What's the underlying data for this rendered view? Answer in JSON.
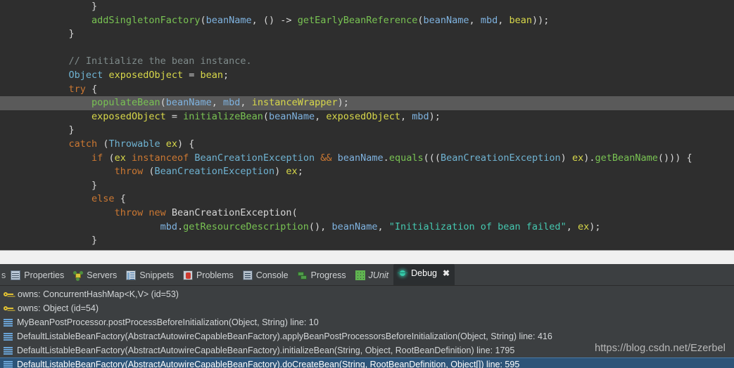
{
  "editor": {
    "language": "java",
    "theme_bg": "#2e2e2e",
    "highlight_bg": "#5a5a5a",
    "highlighted_line_index": 7,
    "lines": [
      {
        "indent": 8,
        "tokens": [
          {
            "t": "}",
            "c": "punc"
          }
        ]
      },
      {
        "indent": 8,
        "tokens": [
          {
            "t": "addSingletonFactory",
            "c": "method"
          },
          {
            "t": "(",
            "c": "punc"
          },
          {
            "t": "beanName",
            "c": "field"
          },
          {
            "t": ", () -> ",
            "c": "punc"
          },
          {
            "t": "getEarlyBeanReference",
            "c": "method"
          },
          {
            "t": "(",
            "c": "punc"
          },
          {
            "t": "beanName",
            "c": "field"
          },
          {
            "t": ", ",
            "c": "punc"
          },
          {
            "t": "mbd",
            "c": "field"
          },
          {
            "t": ", ",
            "c": "punc"
          },
          {
            "t": "bean",
            "c": "var"
          },
          {
            "t": "));",
            "c": "punc"
          }
        ]
      },
      {
        "indent": 4,
        "tokens": [
          {
            "t": "}",
            "c": "punc"
          }
        ]
      },
      {
        "indent": 0,
        "tokens": []
      },
      {
        "indent": 4,
        "tokens": [
          {
            "t": "// Initialize the bean instance.",
            "c": "comment"
          }
        ]
      },
      {
        "indent": 4,
        "tokens": [
          {
            "t": "Object",
            "c": "type"
          },
          {
            "t": " ",
            "c": "punc"
          },
          {
            "t": "exposedObject",
            "c": "var"
          },
          {
            "t": " = ",
            "c": "punc"
          },
          {
            "t": "bean",
            "c": "var"
          },
          {
            "t": ";",
            "c": "punc"
          }
        ]
      },
      {
        "indent": 4,
        "tokens": [
          {
            "t": "try",
            "c": "kw"
          },
          {
            "t": " {",
            "c": "punc"
          }
        ]
      },
      {
        "indent": 8,
        "tokens": [
          {
            "t": "populateBean",
            "c": "method"
          },
          {
            "t": "(",
            "c": "punc"
          },
          {
            "t": "beanName",
            "c": "field"
          },
          {
            "t": ", ",
            "c": "punc"
          },
          {
            "t": "mbd",
            "c": "field"
          },
          {
            "t": ", ",
            "c": "punc"
          },
          {
            "t": "instanceWrapper",
            "c": "var"
          },
          {
            "t": ");",
            "c": "punc"
          }
        ]
      },
      {
        "indent": 8,
        "tokens": [
          {
            "t": "exposedObject",
            "c": "var"
          },
          {
            "t": " = ",
            "c": "punc"
          },
          {
            "t": "initializeBean",
            "c": "method"
          },
          {
            "t": "(",
            "c": "punc"
          },
          {
            "t": "beanName",
            "c": "field"
          },
          {
            "t": ", ",
            "c": "punc"
          },
          {
            "t": "exposedObject",
            "c": "var"
          },
          {
            "t": ", ",
            "c": "punc"
          },
          {
            "t": "mbd",
            "c": "field"
          },
          {
            "t": ");",
            "c": "punc"
          }
        ]
      },
      {
        "indent": 4,
        "tokens": [
          {
            "t": "}",
            "c": "punc"
          }
        ]
      },
      {
        "indent": 4,
        "tokens": [
          {
            "t": "catch",
            "c": "kw"
          },
          {
            "t": " (",
            "c": "punc"
          },
          {
            "t": "Throwable",
            "c": "type"
          },
          {
            "t": " ",
            "c": "punc"
          },
          {
            "t": "ex",
            "c": "var"
          },
          {
            "t": ") {",
            "c": "punc"
          }
        ]
      },
      {
        "indent": 8,
        "tokens": [
          {
            "t": "if",
            "c": "kw"
          },
          {
            "t": " (",
            "c": "punc"
          },
          {
            "t": "ex",
            "c": "var"
          },
          {
            "t": " ",
            "c": "punc"
          },
          {
            "t": "instanceof",
            "c": "kw"
          },
          {
            "t": " ",
            "c": "punc"
          },
          {
            "t": "BeanCreationException",
            "c": "type"
          },
          {
            "t": " ",
            "c": "punc"
          },
          {
            "t": "&&",
            "c": "kw"
          },
          {
            "t": " ",
            "c": "punc"
          },
          {
            "t": "beanName",
            "c": "field"
          },
          {
            "t": ".",
            "c": "punc"
          },
          {
            "t": "equals",
            "c": "method"
          },
          {
            "t": "(((",
            "c": "punc"
          },
          {
            "t": "BeanCreationException",
            "c": "type"
          },
          {
            "t": ") ",
            "c": "punc"
          },
          {
            "t": "ex",
            "c": "var"
          },
          {
            "t": ").",
            "c": "punc"
          },
          {
            "t": "getBeanName",
            "c": "method"
          },
          {
            "t": "())) {",
            "c": "punc"
          }
        ]
      },
      {
        "indent": 12,
        "tokens": [
          {
            "t": "throw",
            "c": "kw"
          },
          {
            "t": " (",
            "c": "punc"
          },
          {
            "t": "BeanCreationException",
            "c": "type"
          },
          {
            "t": ") ",
            "c": "punc"
          },
          {
            "t": "ex",
            "c": "var"
          },
          {
            "t": ";",
            "c": "punc"
          }
        ]
      },
      {
        "indent": 8,
        "tokens": [
          {
            "t": "}",
            "c": "punc"
          }
        ]
      },
      {
        "indent": 8,
        "tokens": [
          {
            "t": "else",
            "c": "kw"
          },
          {
            "t": " {",
            "c": "punc"
          }
        ]
      },
      {
        "indent": 12,
        "tokens": [
          {
            "t": "throw",
            "c": "kw"
          },
          {
            "t": " ",
            "c": "punc"
          },
          {
            "t": "new",
            "c": "kw"
          },
          {
            "t": " ",
            "c": "punc"
          },
          {
            "t": "BeanCreationException",
            "c": "plain"
          },
          {
            "t": "(",
            "c": "punc"
          }
        ]
      },
      {
        "indent": 20,
        "tokens": [
          {
            "t": "mbd",
            "c": "field"
          },
          {
            "t": ".",
            "c": "punc"
          },
          {
            "t": "getResourceDescription",
            "c": "method"
          },
          {
            "t": "(), ",
            "c": "punc"
          },
          {
            "t": "beanName",
            "c": "field"
          },
          {
            "t": ", ",
            "c": "punc"
          },
          {
            "t": "\"Initialization of bean failed\"",
            "c": "string"
          },
          {
            "t": ", ",
            "c": "punc"
          },
          {
            "t": "ex",
            "c": "var"
          },
          {
            "t": ");",
            "c": "punc"
          }
        ]
      },
      {
        "indent": 8,
        "tokens": [
          {
            "t": "}",
            "c": "punc"
          }
        ]
      },
      {
        "indent": 4,
        "tokens": [
          {
            "t": "}",
            "c": "punc"
          }
        ]
      }
    ]
  },
  "panel": {
    "tab_overflow_left": "s",
    "tabs": [
      {
        "label": "Properties",
        "icon": "properties-icon",
        "icon_class": "ic-properties",
        "active": false,
        "italic": false,
        "closable": false
      },
      {
        "label": "Servers",
        "icon": "servers-icon",
        "icon_class": "ic-servers",
        "active": false,
        "italic": false,
        "closable": false
      },
      {
        "label": "Snippets",
        "icon": "snippets-icon",
        "icon_class": "ic-snippets",
        "active": false,
        "italic": false,
        "closable": false
      },
      {
        "label": "Problems",
        "icon": "problems-icon",
        "icon_class": "ic-problems",
        "active": false,
        "italic": false,
        "closable": false
      },
      {
        "label": "Console",
        "icon": "console-icon",
        "icon_class": "ic-console",
        "active": false,
        "italic": false,
        "closable": false
      },
      {
        "label": "Progress",
        "icon": "progress-icon",
        "icon_class": "ic-progress",
        "active": false,
        "italic": false,
        "closable": false
      },
      {
        "label": "JUnit",
        "icon": "junit-icon",
        "icon_class": "ic-junit",
        "active": false,
        "italic": true,
        "closable": false
      },
      {
        "label": "Debug",
        "icon": "debug-icon",
        "icon_class": "ic-debug",
        "active": true,
        "italic": false,
        "closable": true,
        "close_label": "✖"
      }
    ],
    "stack_frames": [
      {
        "icon": "key-icon",
        "icon_class": "ic-key",
        "label": "owns: ConcurrentHashMap<K,V>  (id=53)",
        "selected": false
      },
      {
        "icon": "key-icon",
        "icon_class": "ic-key",
        "label": "owns: Object  (id=54)",
        "selected": false
      },
      {
        "icon": "frame-icon",
        "icon_class": "ic-frame",
        "label": "MyBeanPostProcessor.postProcessBeforeInitialization(Object, String) line: 10",
        "selected": false
      },
      {
        "icon": "frame-icon",
        "icon_class": "ic-frame",
        "label": "DefaultListableBeanFactory(AbstractAutowireCapableBeanFactory).applyBeanPostProcessorsBeforeInitialization(Object, String) line: 416",
        "selected": false
      },
      {
        "icon": "frame-icon",
        "icon_class": "ic-frame",
        "label": "DefaultListableBeanFactory(AbstractAutowireCapableBeanFactory).initializeBean(String, Object, RootBeanDefinition) line: 1795",
        "selected": false
      },
      {
        "icon": "frame-icon",
        "icon_class": "ic-frame",
        "label": "DefaultListableBeanFactory(AbstractAutowireCapableBeanFactory).doCreateBean(String, RootBeanDefinition, Object[]) line: 595",
        "selected": true
      }
    ]
  },
  "watermark": {
    "text": "https://blog.csdn.net/Ezerbel"
  }
}
